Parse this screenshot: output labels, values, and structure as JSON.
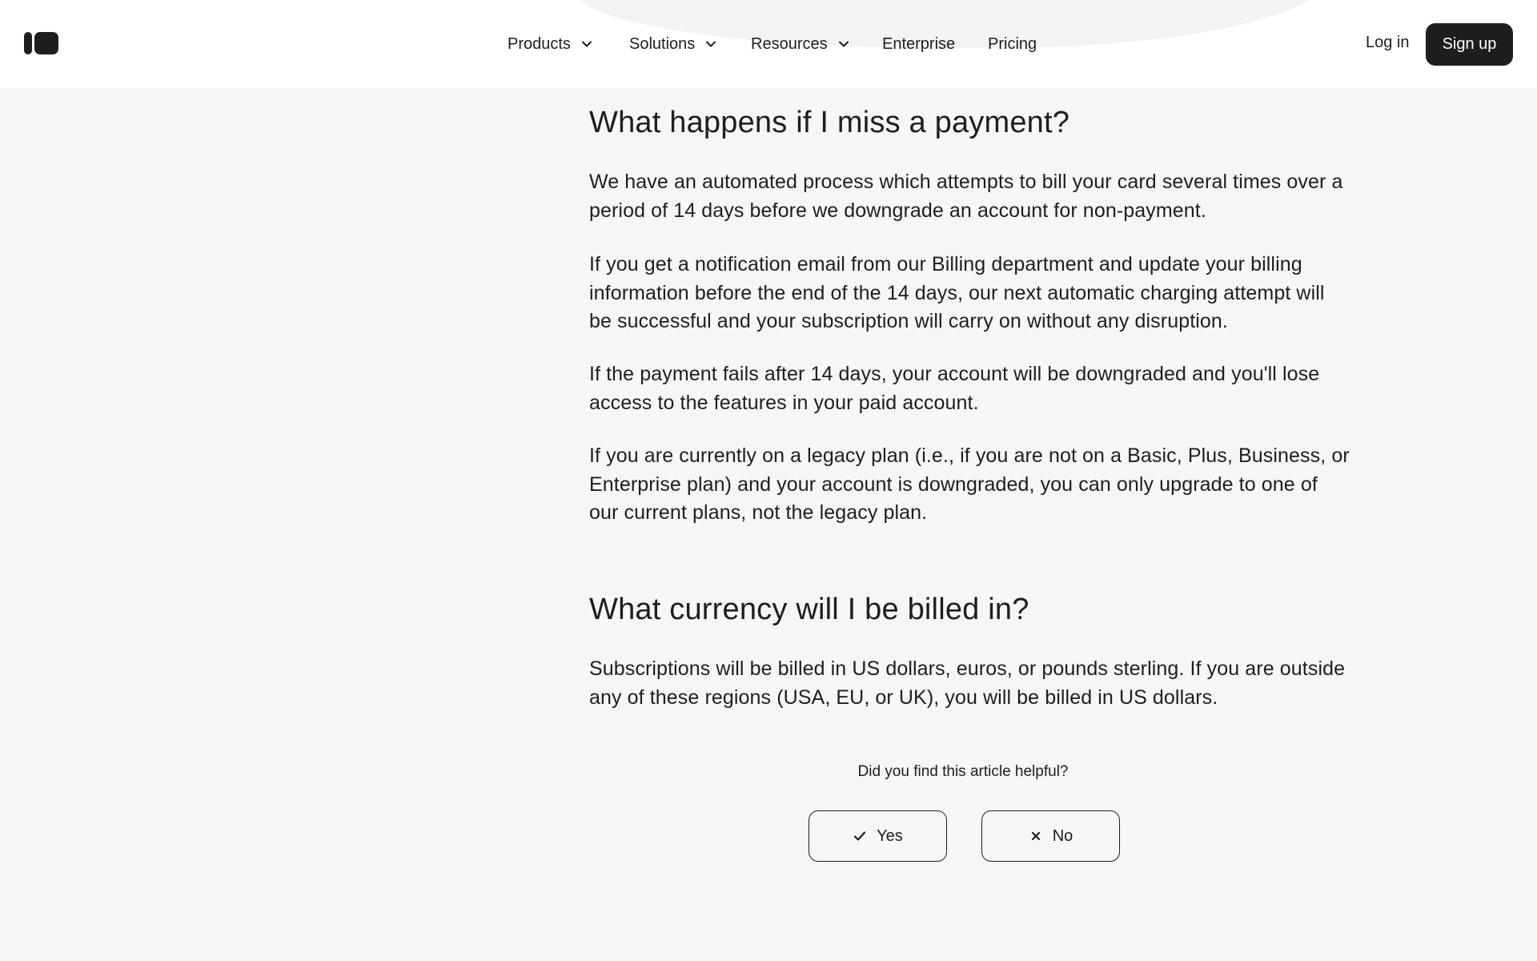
{
  "header": {
    "logo_icon": "brand-logo-icon",
    "nav": {
      "products": "Products",
      "solutions": "Solutions",
      "resources": "Resources",
      "enterprise": "Enterprise",
      "pricing": "Pricing"
    },
    "login_label": "Log in",
    "signup_label": "Sign up"
  },
  "article": {
    "sections": [
      {
        "heading": "What happens if I miss a payment?",
        "paragraphs": [
          "We have an automated process which attempts to bill your card several times over a period of 14 days before we downgrade an account for non-payment.",
          "If you get a notification email from our Billing department and update your billing information before the end of the 14 days, our next automatic charging attempt will be successful and your subscription will carry on without any disruption.",
          "If the payment fails after 14 days, your account will be downgraded and you'll lose access to the features in your paid account.",
          "If you are currently on a legacy plan (i.e., if you are not on a Basic, Plus, Business, or Enterprise plan) and your account is downgraded, you can only upgrade to one of our current plans, not the legacy plan."
        ]
      },
      {
        "heading": "What currency will I be billed in?",
        "paragraphs": [
          "Subscriptions will be billed in US dollars, euros, or pounds sterling. If you are outside any of these regions (USA, EU, or UK), you will be billed in US dollars."
        ]
      }
    ]
  },
  "feedback": {
    "question": "Did you find this article helpful?",
    "yes_label": "Yes",
    "no_label": "No",
    "yes_icon": "check-icon",
    "no_icon": "close-icon"
  },
  "colors": {
    "text": "#1e1e1e",
    "background": "#f6f6f4",
    "header_background": "#ffffff",
    "button_dark": "#1e1e1e"
  }
}
